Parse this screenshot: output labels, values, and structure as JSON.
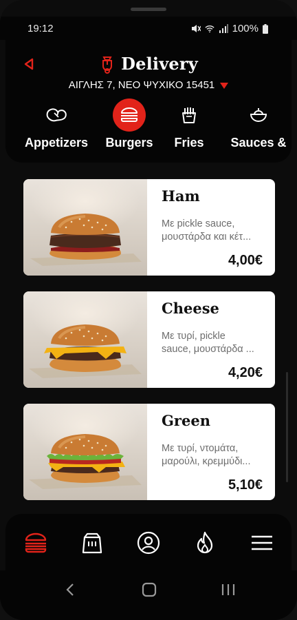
{
  "status_bar": {
    "time": "19:12",
    "battery": "100%"
  },
  "header": {
    "title": "Delivery",
    "address": "ΑΙΓΛΗΣ 7, ΝΕΟ ΨΥΧΙΚΟ 15451"
  },
  "categories": [
    {
      "label": "Appetizers",
      "icon": "appetizers-icon",
      "active": false
    },
    {
      "label": "Burgers",
      "icon": "burger-icon",
      "active": true
    },
    {
      "label": "Fries",
      "icon": "fries-icon",
      "active": false
    },
    {
      "label": "Sauces &",
      "icon": "sauce-bowl-icon",
      "active": false
    }
  ],
  "products": [
    {
      "name": "Ham",
      "desc_line1": "Με pickle sauce,",
      "desc_line2": "μουστάρδα και κέτ...",
      "price": "4,00€",
      "image": "ham-burger-image"
    },
    {
      "name": "Cheese",
      "desc_line1": "Με τυρί, pickle",
      "desc_line2": "sauce, μουστάρδα ...",
      "price": "4,20€",
      "image": "cheese-burger-image"
    },
    {
      "name": "Green",
      "desc_line1": "Με τυρί, ντομάτα,",
      "desc_line2": "μαρούλι, κρεμμύδι...",
      "price": "5,10€",
      "image": "green-burger-image"
    }
  ],
  "bottom_nav": [
    {
      "name": "menu-burger-icon",
      "active": true
    },
    {
      "name": "shopping-bag-icon",
      "active": false
    },
    {
      "name": "profile-icon",
      "active": false
    },
    {
      "name": "flame-icon",
      "active": false
    },
    {
      "name": "hamburger-menu-icon",
      "active": false
    }
  ],
  "colors": {
    "accent": "#e2231a",
    "background": "#101010",
    "card": "#ffffff",
    "text_muted": "#6d6d6d"
  }
}
